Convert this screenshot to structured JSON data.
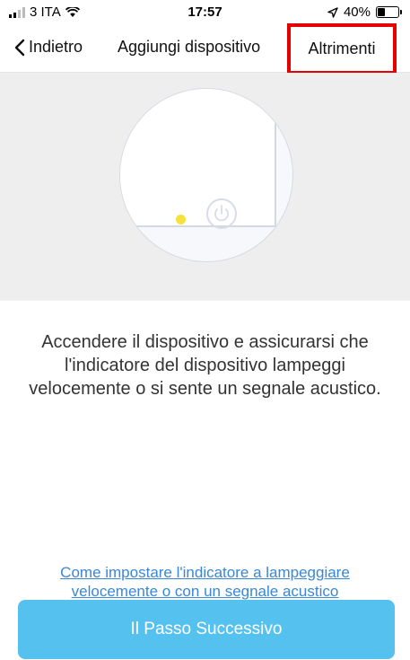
{
  "status_bar": {
    "carrier": "3 ITA",
    "time": "17:57",
    "battery": "40%",
    "battery_level": 0.4,
    "icons": [
      "signal-icon",
      "wifi-icon",
      "location-icon",
      "battery-icon"
    ]
  },
  "nav": {
    "back_label": "Indietro",
    "title": "Aggiungi dispositivo",
    "other_label": "Altrimenti",
    "highlight_color": "#e60000"
  },
  "illustration": {
    "led_color": "#f7e23a",
    "icons": [
      "power-icon"
    ]
  },
  "instruction": "Accendere il dispositivo e assicurarsi che l'indicatore del dispositivo lampeggi velocemente o si sente un segnale acustico.",
  "help_link": "Come impostare l'indicatore a lampeggiare velocemente o con un segnale acustico",
  "next_button": "Il Passo Successivo",
  "colors": {
    "accent": "#55c1ef",
    "link": "#3a87d6"
  }
}
